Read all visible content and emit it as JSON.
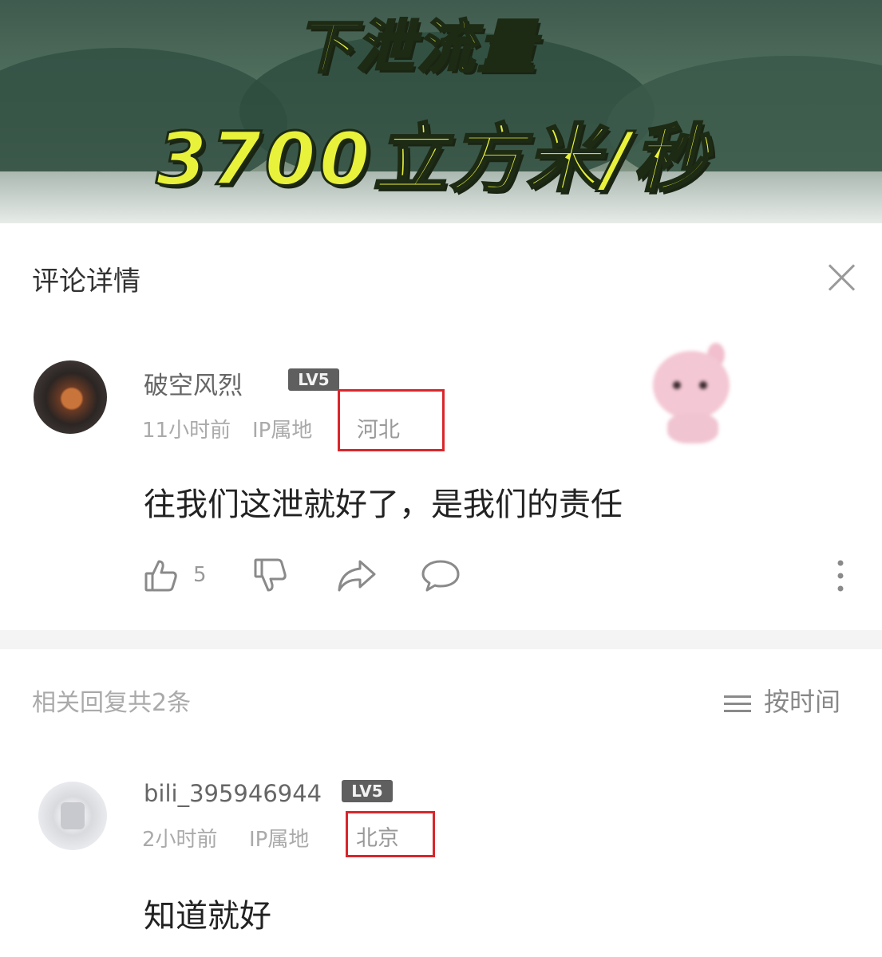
{
  "banner": {
    "caption_line1": "下泄流量",
    "caption_line2": "3700立方米/秒"
  },
  "panel": {
    "title": "评论详情"
  },
  "comment": {
    "username": "破空风烈",
    "level_badge": "LV5",
    "time": "11小时前",
    "ip_label": "IP属地",
    "ip_location": "河北",
    "text": "往我们这泄就好了，是我们的责任",
    "like_count": "5"
  },
  "replies": {
    "header": "相关回复共2条",
    "sort_label": "按时间",
    "items": [
      {
        "username": "bili_395946944",
        "level_badge": "LV5",
        "time": "2小时前",
        "ip_label": "IP属地",
        "ip_location": "北京",
        "text": "知道就好"
      }
    ]
  },
  "icons": {
    "close": "close-icon",
    "like": "thumbs-up-icon",
    "dislike": "thumbs-down-icon",
    "share": "share-icon",
    "reply": "reply-bubble-icon",
    "more": "more-vertical-icon",
    "sort": "sort-lines-icon"
  },
  "colors": {
    "highlight_box": "#d9262b",
    "caption_yellow": "#e9f23a"
  }
}
